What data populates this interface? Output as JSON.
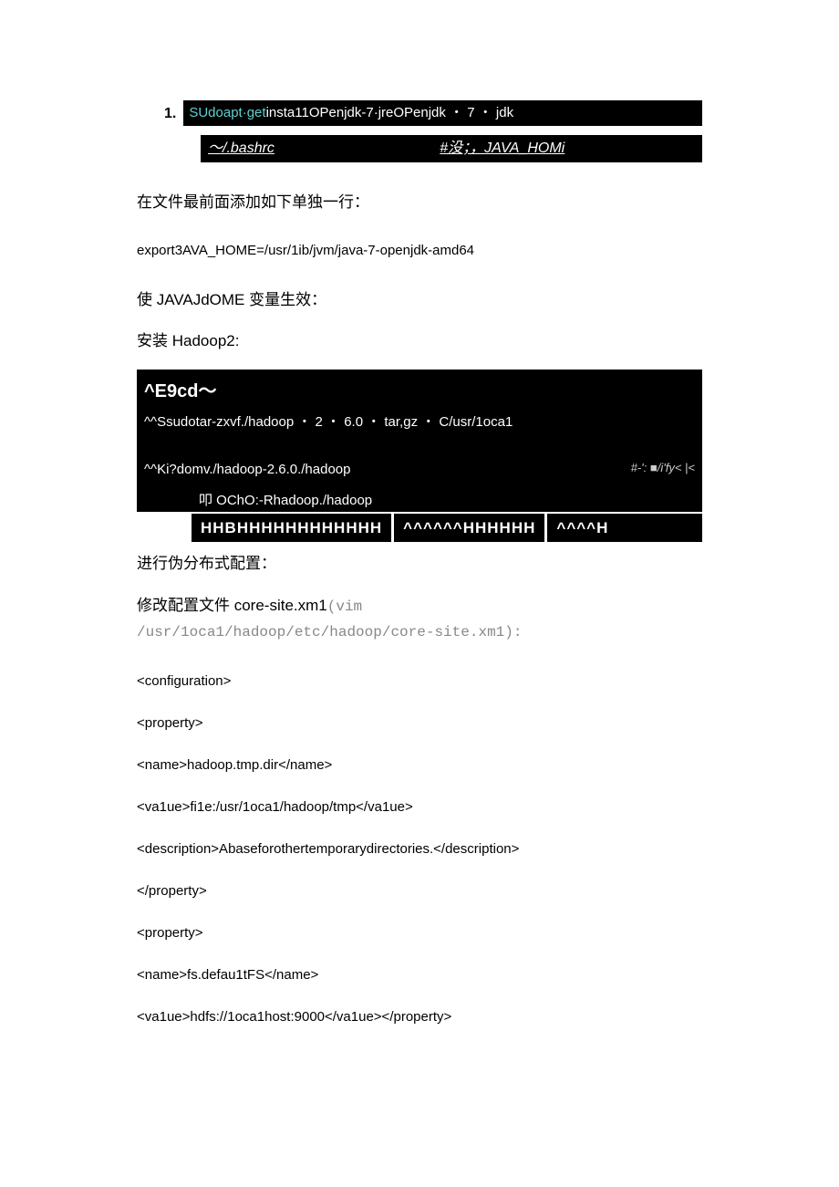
{
  "item1": {
    "num": "1.",
    "pre": "SUdoapt·get",
    "rest": "insta11OPenjdk-7·jreOPenjdk ・ 7 ・ jdk"
  },
  "bashrc": {
    "left": "〜/.bashrc",
    "right": "#没；，JAVA_HOMi"
  },
  "para1": "在文件最前面添加如下单独一行：",
  "export_line": "export3AVA_HOME=/usr/1ib/jvm/java-7-openjdk-amd64",
  "para2": "使 JAVAJdOME 变量生效：",
  "para3": "安装 Hadoop2:",
  "bb": {
    "header": "^E9cd〜",
    "l1a": "^^Ssudo",
    "l1b": "tar",
    "l1c": "-zxvf",
    "l1d": "./hadoop ・ 2 ・ 6.0 ・ tar,gz ・ C/usr/1oca1",
    "l2a": "^^Ki?do",
    "l2b": "mv",
    "l2c": "./hadoop-2.6.0./hadoop",
    "l2r": "#-':  ■/i'fy< |<",
    "l3a": "叩 ",
    "l3b": "OChO",
    "l3c": ":-Rhadoop./hadoop",
    "f1": "HHBHHHHHHHHHHHH",
    "f2": "^^^^^^HHHHHH",
    "f3": "^^^^H"
  },
  "para4": "进行伪分布式配置：",
  "para5a": "修改配置文件 core-site.xm1",
  "para5b": "(vim",
  "para5c": "/usr/1oca1/hadoop/etc/hadoop/core-site.xm1):",
  "xml": {
    "l1": "<configuration>",
    "l2": "<property>",
    "l3": "<name>hadoop.tmp.dir</name>",
    "l4": "<va1ue>fi1e:/usr/1oca1/hadoop/tmp</va1ue>",
    "l5": "<description>Abaseforothertemporarydirectories.</description>",
    "l6": "</property>",
    "l7": "<property>",
    "l8": "<name>fs.defau1tFS</name>",
    "l9": "<va1ue>hdfs://1oca1host:9000</va1ue></property>"
  }
}
